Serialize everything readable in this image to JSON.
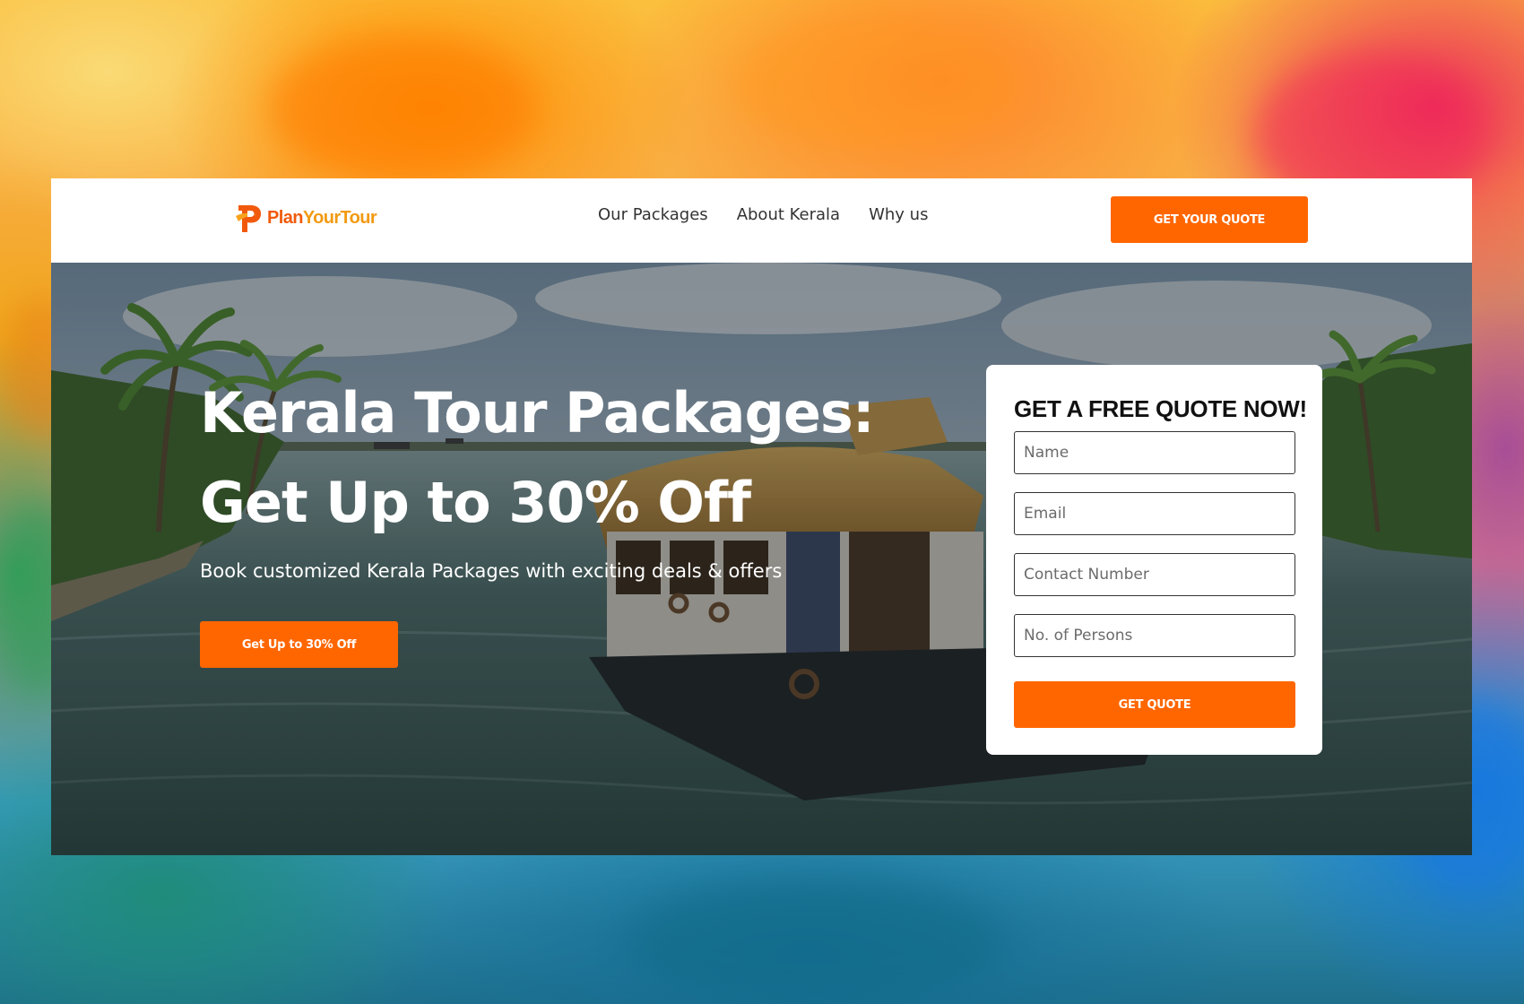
{
  "brand": {
    "name_part1": "Plan",
    "name_part2": "YourTour",
    "primary_color": "#ff6600",
    "logo_icon": "plan-your-tour-logo-icon"
  },
  "nav": {
    "links": [
      {
        "label": "Our Packages"
      },
      {
        "label": "About Kerala"
      },
      {
        "label": "Why us"
      }
    ],
    "cta_label": "GET YOUR QUOTE"
  },
  "hero": {
    "title_line1": "Kerala Tour Packages:",
    "title_line2": "Get Up to 30% Off",
    "subtitle": "Book customized Kerala Packages with exciting deals & offers",
    "cta_label": "Get Up to 30% Off",
    "background": "kerala-backwaters-houseboat-photo"
  },
  "quote_form": {
    "heading": "GET A FREE QUOTE NOW!",
    "fields": [
      {
        "placeholder": "Name",
        "value": ""
      },
      {
        "placeholder": "Email",
        "value": ""
      },
      {
        "placeholder": "Contact Number",
        "value": ""
      },
      {
        "placeholder": "No. of Persons",
        "value": ""
      }
    ],
    "submit_label": "GET QUOTE"
  }
}
